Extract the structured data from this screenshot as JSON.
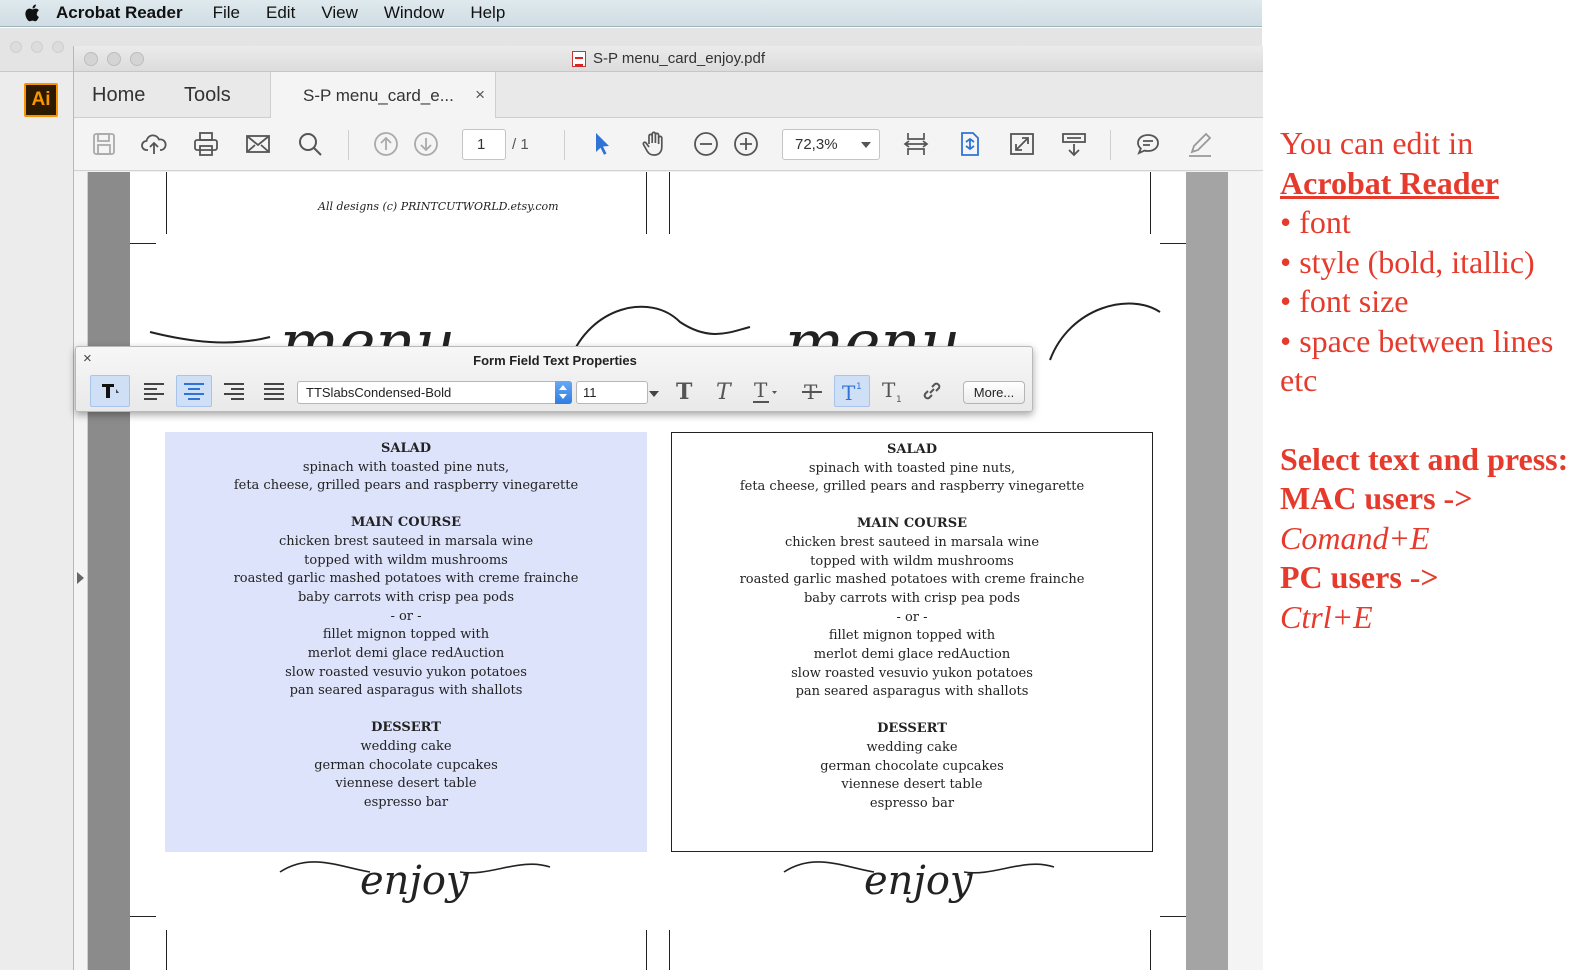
{
  "menubar": {
    "app_name": "Acrobat Reader",
    "items": [
      "File",
      "Edit",
      "View",
      "Window",
      "Help"
    ]
  },
  "background_app": {
    "logo_text": "Ai"
  },
  "window": {
    "title": "S-P menu_card_enjoy.pdf",
    "tabs": {
      "home": "Home",
      "tools": "Tools",
      "document": "S-P menu_card_e...",
      "close": "×"
    }
  },
  "toolbar": {
    "page_current": "1",
    "page_total": "/ 1",
    "zoom": "72,3%",
    "icons": [
      "save-icon",
      "upload-cloud-icon",
      "print-icon",
      "email-icon",
      "search-icon",
      "page-up-icon",
      "page-down-icon",
      "select-arrow-icon",
      "hand-icon",
      "zoom-out-icon",
      "zoom-in-icon",
      "scroll-mode-icon",
      "fit-page-icon",
      "full-screen-icon",
      "read-mode-icon",
      "comment-icon",
      "pen-icon"
    ]
  },
  "document": {
    "credit": "All designs (c) PRINTCUTWORLD.etsy.com",
    "cards": [
      {
        "sections": [
          {
            "head": "SALAD",
            "lines": [
              "spinach with toasted pine nuts,",
              "feta cheese, grilled pears and raspberry vinegarette"
            ]
          },
          {
            "head": "MAIN COURSE",
            "lines": [
              "chicken brest sauteed in marsala wine",
              "topped with wildm mushrooms",
              "roasted garlic mashed potatoes with creme frainche",
              "baby carrots with crisp pea pods",
              "- or -",
              "fillet mignon topped with",
              "merlot demi glace redAuction",
              "slow roasted vesuvio yukon potatoes",
              "pan seared asparagus with shallots"
            ]
          },
          {
            "head": "DESSERT",
            "lines": [
              "wedding cake",
              "german chocolate cupcakes",
              "viennese desert table",
              "espresso bar"
            ]
          }
        ]
      },
      {
        "sections": [
          {
            "head": "SALAD",
            "lines": [
              "spinach with toasted pine nuts,",
              "feta cheese, grilled pears and raspberry vinegarette"
            ]
          },
          {
            "head": "MAIN COURSE",
            "lines": [
              "chicken brest sauteed in marsala wine",
              "topped with wildm mushrooms",
              "roasted garlic mashed potatoes with creme frainche",
              "baby carrots with crisp pea pods",
              "- or -",
              "fillet mignon topped with",
              "merlot demi glace redAuction",
              "slow roasted vesuvio yukon potatoes",
              "pan seared asparagus with shallots"
            ]
          },
          {
            "head": "DESSERT",
            "lines": [
              "wedding cake",
              "german chocolate cupcakes",
              "viennese desert table",
              "espresso bar"
            ]
          }
        ]
      }
    ],
    "script_heading": "menu",
    "script_footer": "enjoy"
  },
  "palette": {
    "title": "Form Field Text Properties",
    "close": "×",
    "font": "TTSlabsCondensed-Bold",
    "size": "11",
    "more_label": "More...",
    "selected_alignment": "center"
  },
  "annotation": {
    "color": "#e53a2c",
    "line1": "You can edit in",
    "line2": "Acrobat Reader",
    "bullets": [
      "• font",
      "• style (bold, itallic)",
      "• font size",
      "• space between lines"
    ],
    "etc": "etc",
    "select_text": "Select text and press:",
    "mac_label": "MAC users ->",
    "mac_shortcut": "Comand+E",
    "pc_label": "PC users ->",
    "pc_shortcut": "Ctrl+E"
  }
}
